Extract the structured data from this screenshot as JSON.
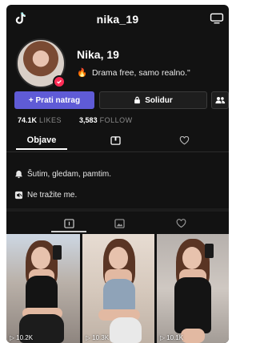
{
  "header": {
    "username": "nika_19",
    "logo_icon": "tiktok-logo-icon",
    "right_icon": "tv-icon"
  },
  "profile": {
    "display_name": "Nika, 19",
    "bio": "Drama free, samo realno.\"",
    "bio_emoji": "🔥",
    "avatar_badge_icon": "check-badge-icon"
  },
  "buttons": {
    "follow_back": "+ Prati natrag",
    "subscribe": "Solidur",
    "subscribe_icon": "lock-icon",
    "friends_icon": "add-friends-icon"
  },
  "stats": {
    "likes_value": "74.1K",
    "likes_label": "LIKES",
    "follow_value": "3,583",
    "follow_label": "FOLLOW"
  },
  "tabs_top": {
    "active_label": "Objave",
    "second_icon": "box-icon",
    "third_icon": "heart-outline-icon"
  },
  "status_lines": [
    {
      "icon": "bell-icon",
      "text": "Šutim, gledam, pamtim."
    },
    {
      "icon": "mute-icon",
      "text": "Ne tražite me."
    }
  ],
  "tabs_bottom": {
    "icons": [
      "videos-icon",
      "image-icon",
      "heart-icon"
    ]
  },
  "videos": [
    {
      "views": "10.2K"
    },
    {
      "views": "10.3K"
    },
    {
      "views": "10.1K"
    }
  ],
  "colors": {
    "accent": "#5f5bd6",
    "brand_red": "#fe2c55",
    "background": "#121212"
  }
}
